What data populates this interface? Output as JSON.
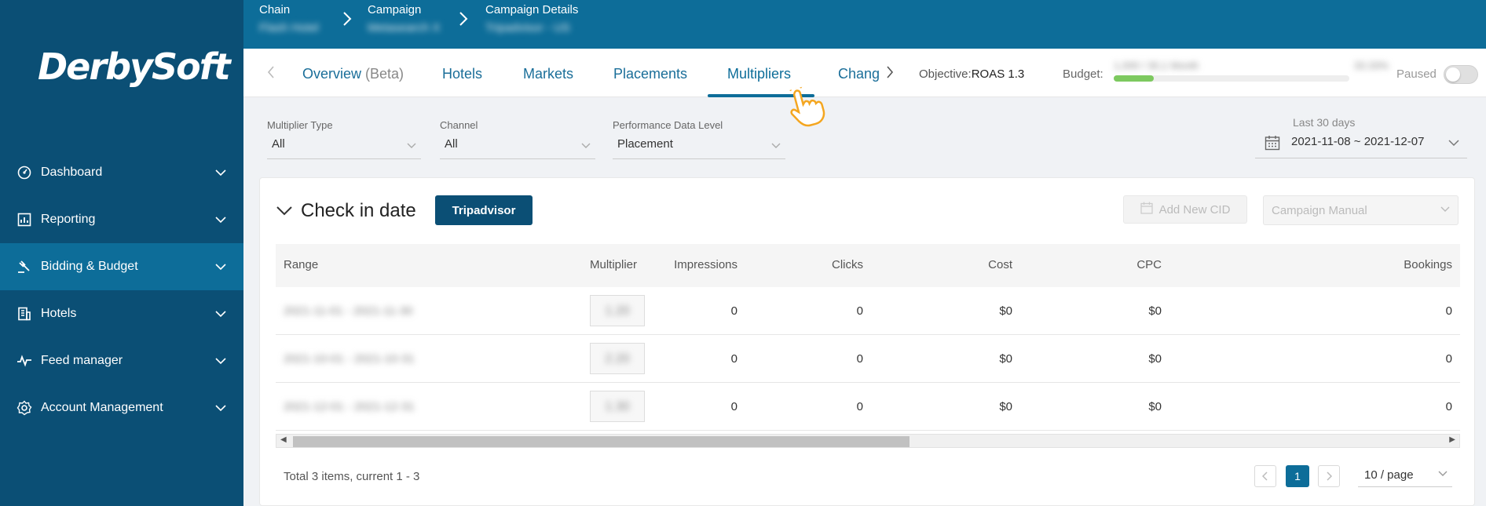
{
  "brand": {
    "logo": "DerbySoft"
  },
  "sidebar": {
    "items": [
      {
        "label": "Dashboard",
        "icon": "dashboard-icon"
      },
      {
        "label": "Reporting",
        "icon": "reporting-icon"
      },
      {
        "label": "Bidding & Budget",
        "icon": "gavel-icon",
        "active": true
      },
      {
        "label": "Hotels",
        "icon": "building-icon"
      },
      {
        "label": "Feed manager",
        "icon": "pulse-icon"
      },
      {
        "label": "Account Management",
        "icon": "gear-icon"
      }
    ]
  },
  "breadcrumb": [
    {
      "label": "Chain",
      "sub": "Flash Hotel"
    },
    {
      "label": "Campaign",
      "sub": "Metasearch X"
    },
    {
      "label": "Campaign Details",
      "sub": "Tripadvisor - US"
    }
  ],
  "tabs": {
    "items": [
      "Overview",
      "Hotels",
      "Markets",
      "Placements",
      "Multipliers",
      "Chang"
    ],
    "overview_suffix": "(Beta)",
    "active_index": 4
  },
  "status": {
    "objective_label": "Objective:",
    "objective_value": "ROAS 1.3",
    "budget_label": "Budget:",
    "budget_blurred": "1,000 / 30,1 Month",
    "budget_blurred_right": "33.33%",
    "budget_progress": 0.17,
    "paused_label": "Paused"
  },
  "filters": {
    "multiplier_type": {
      "label": "Multiplier Type",
      "value": "All"
    },
    "channel": {
      "label": "Channel",
      "value": "All"
    },
    "performance_level": {
      "label": "Performance Data Level",
      "value": "Placement"
    },
    "date": {
      "label": "Last 30 days",
      "value": "2021-11-08 ~ 2021-12-07"
    }
  },
  "card": {
    "title": "Check in date",
    "tag_button": "Tripadvisor",
    "add_cid": "Add New CID",
    "campaign_select": "Campaign Manual"
  },
  "table": {
    "columns": [
      "Range",
      "Multiplier",
      "Impressions",
      "Clicks",
      "Cost",
      "CPC",
      "Bookings"
    ],
    "rows": [
      {
        "range": "2021-11-01 - 2021-11-30",
        "multiplier": "1.20",
        "impressions": "0",
        "clicks": "0",
        "cost": "$0",
        "cpc": "$0",
        "bookings": "0"
      },
      {
        "range": "2021-10-01 - 2021-10-31",
        "multiplier": "2.20",
        "impressions": "0",
        "clicks": "0",
        "cost": "$0",
        "cpc": "$0",
        "bookings": "0"
      },
      {
        "range": "2021-12-01 - 2021-12-31",
        "multiplier": "1.30",
        "impressions": "0",
        "clicks": "0",
        "cost": "$0",
        "cpc": "$0",
        "bookings": "0"
      }
    ]
  },
  "pagination": {
    "total_text": "Total 3 items, current 1 - 3",
    "current_page": "1",
    "page_size": "10 / page"
  },
  "colors": {
    "sidebar": "#0b4f75",
    "header": "#0d6d99",
    "active_nav": "#0d6d99",
    "accent": "#0d6d99",
    "progress": "#7dc95f",
    "cursor": "#f4a620"
  }
}
